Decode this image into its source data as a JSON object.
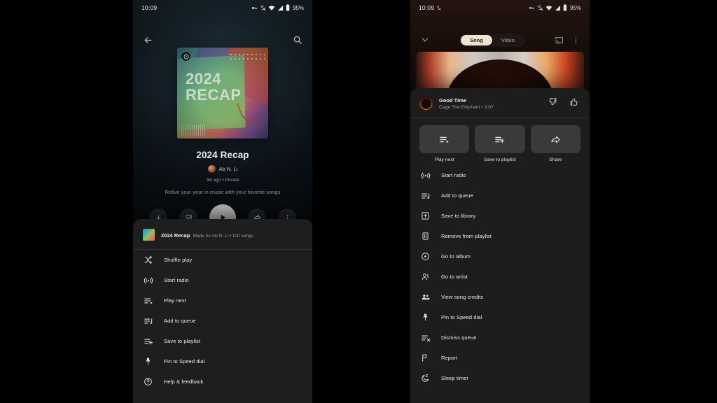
{
  "left_phone": {
    "status_bar": {
      "time": "10:09",
      "battery": "95%",
      "icons": [
        "key-icon",
        "notifications-muted-icon",
        "wifi-icon",
        "cellular-signal-icon",
        "battery-icon"
      ]
    },
    "nav": {
      "back": "back-arrow-icon",
      "search": "search-icon"
    },
    "hero": {
      "art_line1": "2024",
      "art_line2": "RECAP",
      "badge": "youtube-music-badge"
    },
    "details": {
      "title": "2024 Recap",
      "owner": "Ab N. Li",
      "subtitle": "3w ago • Private",
      "description": "Relive your year in music with your favorite songs"
    },
    "controls": [
      {
        "name": "download-button",
        "icon": "download-icon"
      },
      {
        "name": "saved-button",
        "icon": "checkbox-checked-icon"
      },
      {
        "name": "play-button",
        "icon": "play-icon"
      },
      {
        "name": "share-button",
        "icon": "share-icon"
      },
      {
        "name": "more-options-button",
        "icon": "more-vertical-icon"
      }
    ],
    "sheet": {
      "header": {
        "title": "2024 Recap",
        "subtitle": "Made for Ab N. Li • 100 songs"
      },
      "items": [
        {
          "label": "Shuffle play",
          "icon": "shuffle-icon"
        },
        {
          "label": "Start radio",
          "icon": "radio-icon"
        },
        {
          "label": "Play next",
          "icon": "play-next-icon"
        },
        {
          "label": "Add to queue",
          "icon": "add-to-queue-icon"
        },
        {
          "label": "Save to playlist",
          "icon": "save-to-playlist-icon"
        },
        {
          "label": "Pin to Speed dial",
          "icon": "pin-icon"
        },
        {
          "label": "Help & feedback",
          "icon": "help-circle-icon"
        }
      ]
    }
  },
  "right_phone": {
    "status_bar": {
      "time": "10:09",
      "battery": "95%",
      "icons": [
        "key-icon",
        "notifications-muted-icon",
        "wifi-icon",
        "cellular-signal-icon",
        "battery-icon"
      ]
    },
    "header": {
      "collapse": "chevron-down-icon",
      "toggle": {
        "options": [
          "Song",
          "Video"
        ],
        "selected": "Song"
      },
      "cast": "cast-icon",
      "more": "more-vertical-icon"
    },
    "now_playing": {
      "title": "Good Time",
      "subtitle": "Cage The Elephant • 3:07",
      "dislike": "thumb-down-icon",
      "like": "thumb-up-icon"
    },
    "quick_actions": [
      {
        "label": "Play next",
        "icon": "play-next-icon"
      },
      {
        "label": "Save to playlist",
        "icon": "save-to-playlist-icon"
      },
      {
        "label": "Share",
        "icon": "share-icon"
      }
    ],
    "items": [
      {
        "label": "Start radio",
        "icon": "radio-icon"
      },
      {
        "label": "Add to queue",
        "icon": "add-to-queue-icon"
      },
      {
        "label": "Save to library",
        "icon": "save-to-library-icon"
      },
      {
        "label": "Remove from playlist",
        "icon": "remove-icon"
      },
      {
        "label": "Go to album",
        "icon": "album-icon"
      },
      {
        "label": "Go to artist",
        "icon": "artist-icon"
      },
      {
        "label": "View song credits",
        "icon": "credits-icon"
      },
      {
        "label": "Pin to Speed dial",
        "icon": "pin-icon"
      },
      {
        "label": "Dismiss queue",
        "icon": "dismiss-queue-icon"
      },
      {
        "label": "Report",
        "icon": "flag-icon"
      },
      {
        "label": "Sleep timer",
        "icon": "sleep-timer-icon"
      }
    ]
  },
  "colors": {
    "sheet_bg": "#1d1d1d",
    "accent_pill": "#efe3d4",
    "text_primary": "#ececec",
    "text_secondary": "#9e9e9e"
  }
}
